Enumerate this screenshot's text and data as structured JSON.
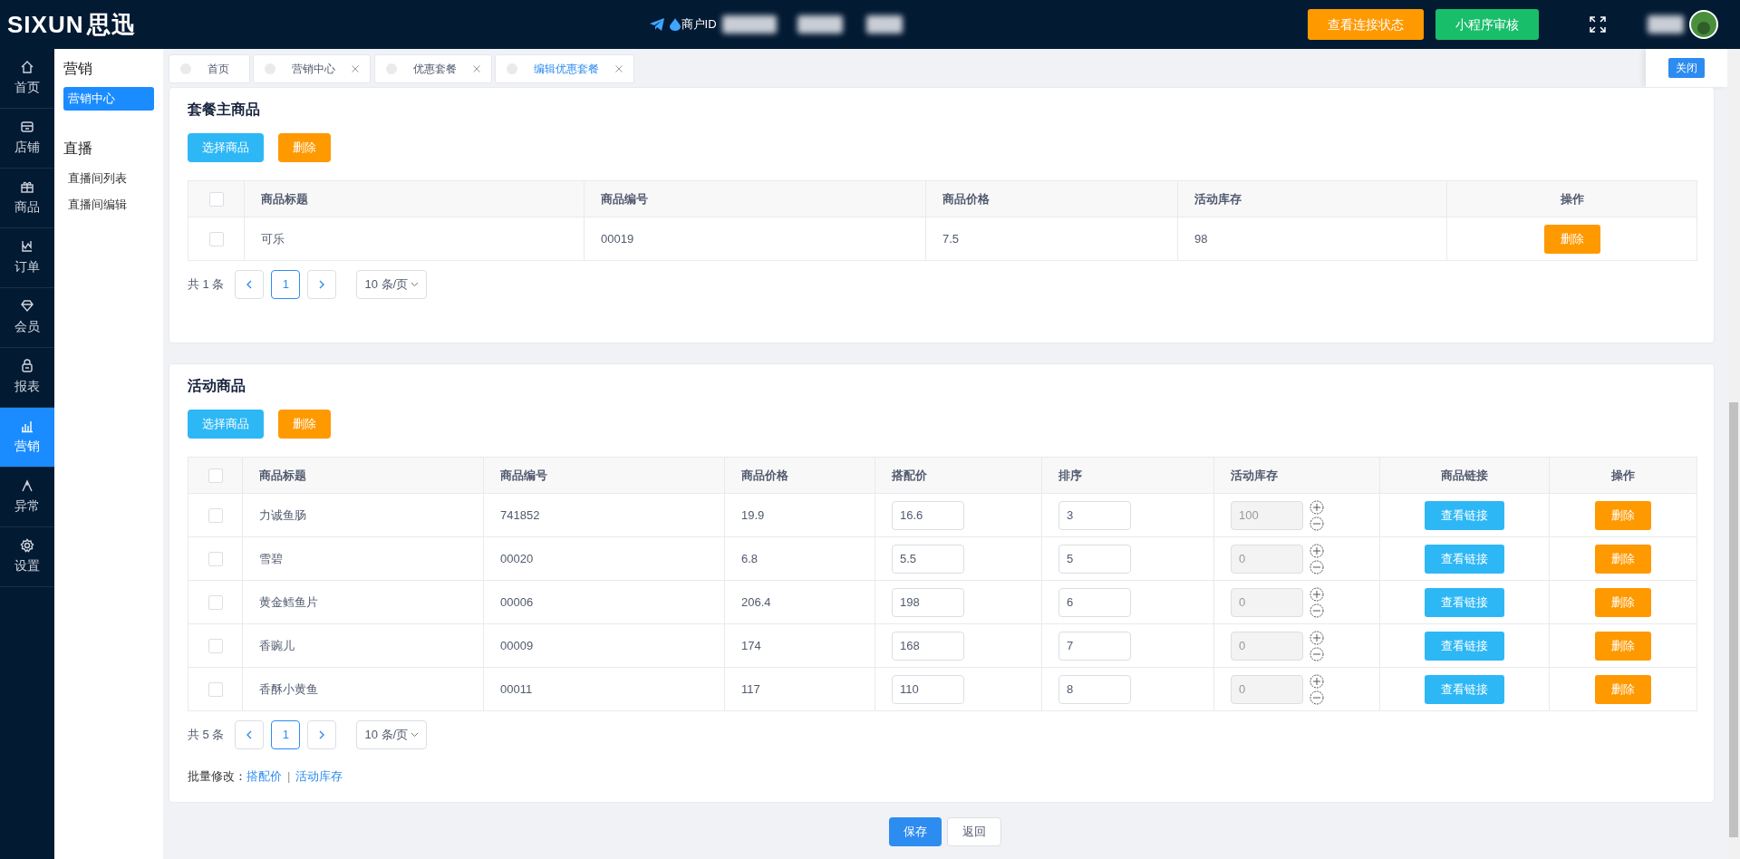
{
  "header": {
    "logo_text": "SIXUN",
    "logo_cn": "思迅",
    "merchant_label": "商户ID",
    "buttons": [
      {
        "label": "查看连接状态",
        "kind": "warning"
      },
      {
        "label": "小程序审核",
        "kind": "success"
      }
    ]
  },
  "nav_rail": [
    {
      "label": "首页",
      "selected": false
    },
    {
      "label": "店铺",
      "selected": false
    },
    {
      "label": "商品",
      "selected": false
    },
    {
      "label": "订单",
      "selected": false
    },
    {
      "label": "会员",
      "selected": false
    },
    {
      "label": "报表",
      "selected": false
    },
    {
      "label": "营销",
      "selected": true
    },
    {
      "label": "异常",
      "selected": false
    },
    {
      "label": "设置",
      "selected": false
    }
  ],
  "submenu": [
    {
      "title": "营销",
      "items": [
        {
          "label": "营销中心",
          "selected": true
        }
      ]
    },
    {
      "title": "直播",
      "items": [
        {
          "label": "直播间列表",
          "selected": false
        },
        {
          "label": "直播间编辑",
          "selected": false
        }
      ]
    }
  ],
  "tabs": [
    {
      "label": "首页",
      "selected": false,
      "closable": false
    },
    {
      "label": "营销中心",
      "selected": false,
      "closable": true
    },
    {
      "label": "优惠套餐",
      "selected": false,
      "closable": true
    },
    {
      "label": "编辑优惠套餐",
      "selected": true,
      "closable": true
    }
  ],
  "close_button": "关闭",
  "main_section": {
    "title": "套餐主商品",
    "buttons": [
      {
        "label": "选择商品",
        "kind": "info"
      },
      {
        "label": "删除",
        "kind": "warning"
      }
    ],
    "header_checked": false,
    "columns": [
      "商品标题",
      "商品编号",
      "商品价格",
      "活动库存",
      "操作"
    ],
    "rows": [
      {
        "checked": false,
        "title": "可乐",
        "code": "00019",
        "price": "7.5",
        "stock": "98",
        "action": "删除"
      }
    ],
    "pagination": {
      "total": "共 1 条",
      "page": "1",
      "page_size": "10 条/页"
    }
  },
  "activity_section": {
    "title": "活动商品",
    "buttons": [
      {
        "label": "选择商品",
        "kind": "info"
      },
      {
        "label": "删除",
        "kind": "warning"
      }
    ],
    "header_checked": false,
    "columns": [
      "商品标题",
      "商品编号",
      "商品价格",
      "搭配价",
      "排序",
      "活动库存",
      "商品链接",
      "操作"
    ],
    "rows": [
      {
        "checked": false,
        "title": "力诚鱼肠",
        "code": "741852",
        "price": "19.9",
        "match_price": "16.6",
        "sort": "3",
        "stock": "100",
        "stock_disabled": true,
        "link": "查看链接",
        "action": "删除"
      },
      {
        "checked": false,
        "title": "雪碧",
        "code": "00020",
        "price": "6.8",
        "match_price": "5.5",
        "sort": "5",
        "stock": "0",
        "stock_disabled": true,
        "link": "查看链接",
        "action": "删除"
      },
      {
        "checked": false,
        "title": "黄金鳕鱼片",
        "code": "00006",
        "price": "206.4",
        "match_price": "198",
        "sort": "6",
        "stock": "0",
        "stock_disabled": true,
        "link": "查看链接",
        "action": "删除"
      },
      {
        "checked": false,
        "title": "香豌儿",
        "code": "00009",
        "price": "174",
        "match_price": "168",
        "sort": "7",
        "stock": "0",
        "stock_disabled": true,
        "link": "查看链接",
        "action": "删除"
      },
      {
        "checked": false,
        "title": "香酥小黄鱼",
        "code": "00011",
        "price": "117",
        "match_price": "110",
        "sort": "8",
        "stock": "0",
        "stock_disabled": true,
        "link": "查看链接",
        "action": "删除"
      }
    ],
    "pagination": {
      "total": "共 5 条",
      "page": "1",
      "page_size": "10 条/页"
    },
    "bulk_edit": {
      "label": "批量修改：",
      "links": [
        "搭配价",
        "活动库存"
      ],
      "separator": "|"
    }
  },
  "footer_buttons": [
    {
      "label": "保存",
      "kind": "primary"
    },
    {
      "label": "返回",
      "kind": "default"
    }
  ]
}
